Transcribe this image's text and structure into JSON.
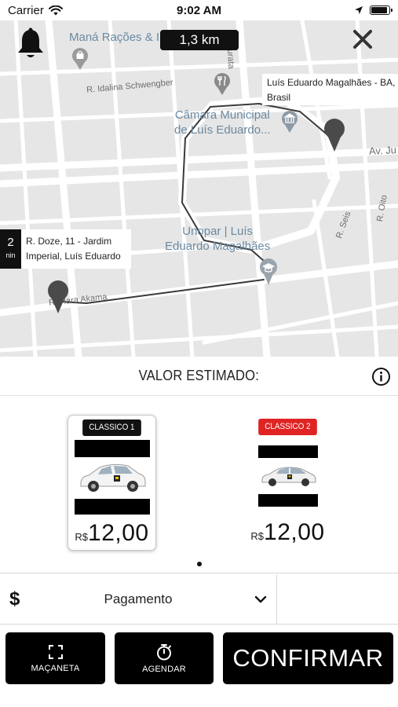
{
  "status_bar": {
    "carrier": "Carrier",
    "time": "9:02 AM"
  },
  "map": {
    "distance": "1,3 km",
    "street_labels": {
      "idalina": "R. Idalina Schwengber",
      "murata": "o Murata",
      "doze": "",
      "seis": "R. Seis",
      "oito": "R. Oito",
      "av_ju": "Av. Ju",
      "akama": "R. Hara Akama"
    },
    "pois": {
      "mana": "Maná Rações & I",
      "camara": "Câmara Municipal\nde Luís Eduardo...",
      "unopar": "Unopar | Luís\nEduardo Magalhães"
    },
    "destination_card": "Luís Eduardo Magalhães - BA,\nBrasil",
    "origin_card": {
      "eta_value": "2",
      "eta_unit": "nin",
      "address": "R. Doze, 11 - Jardim\nImperial, Luís Eduardo"
    },
    "accent_route_color": "#3a3a3a"
  },
  "estimate": {
    "title": "VALOR ESTIMADO:"
  },
  "vehicles": [
    {
      "tag": "CLASSICO 1",
      "tag_color": "#111111",
      "currency": "R$",
      "amount": "12,00",
      "selected": true
    },
    {
      "tag": "CLASSICO 2",
      "tag_color": "#e02424",
      "currency": "R$",
      "amount": "12,00",
      "selected": false
    }
  ],
  "payment": {
    "icon": "$",
    "label": "Pagamento"
  },
  "buttons": {
    "macaneta": "MAÇANETA",
    "agendar": "AGENDAR",
    "confirmar": "CONFIRMAR"
  }
}
